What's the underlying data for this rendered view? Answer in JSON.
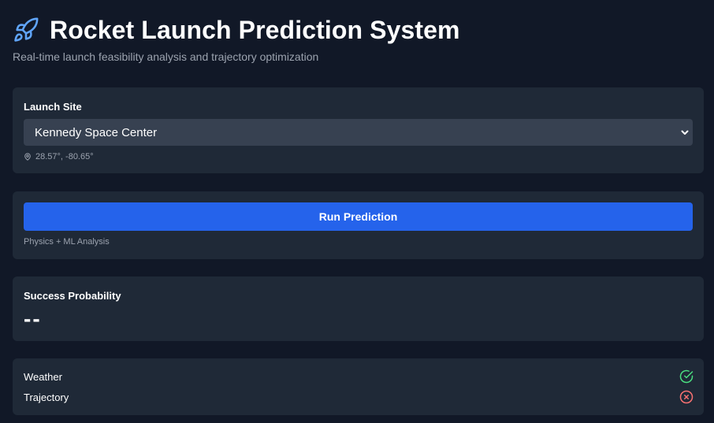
{
  "header": {
    "title": "Rocket Launch Prediction System",
    "subtitle": "Real-time launch feasibility analysis and trajectory optimization",
    "icon": "rocket-icon"
  },
  "launch_site": {
    "label": "Launch Site",
    "selected": "Kennedy Space Center",
    "coordinates": "28.57°, -80.65°"
  },
  "run": {
    "button_label": "Run Prediction",
    "caption": "Physics + ML Analysis"
  },
  "success": {
    "label": "Success Probability",
    "value": "--"
  },
  "checks": [
    {
      "label": "Weather",
      "status": "pass",
      "icon": "check-circle-icon",
      "color": "#4ade80"
    },
    {
      "label": "Trajectory",
      "status": "fail",
      "icon": "x-circle-icon",
      "color": "#f87171"
    }
  ],
  "colors": {
    "background": "#111827",
    "card": "#1f2937",
    "select": "#374151",
    "accent": "#2563eb",
    "icon_blue": "#60a5fa"
  }
}
